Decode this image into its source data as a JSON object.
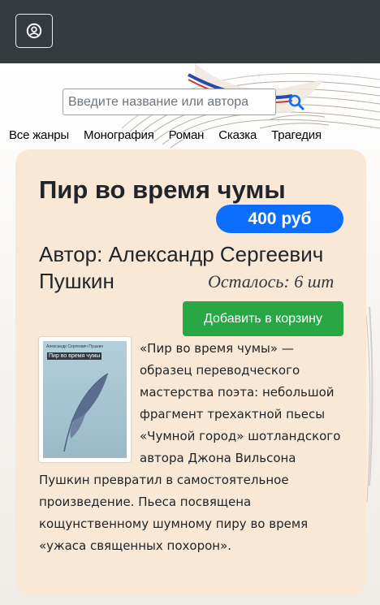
{
  "navbar": {
    "user_icon": "user-circle-icon"
  },
  "search": {
    "placeholder": "Введите название или автора",
    "icon": "search-icon",
    "icon_color": "#0d6efd"
  },
  "genres": [
    "Все жанры",
    "Монография",
    "Роман",
    "Сказка",
    "Трагедия"
  ],
  "book": {
    "title": "Пир во время чумы",
    "price": "400 руб",
    "author": "Автор: Александр Сергеевич Пушкин",
    "stock": "Осталось: 6 шт",
    "add_to_cart": "Добавить в корзину",
    "cover": {
      "author": "Александр Сергеевич Пушкин",
      "title": "Пир во время чумы",
      "icon": "feather-icon"
    },
    "description": "«Пир во время чумы» — образец переводческого мастерства поэта: небольшой фрагмент трехактной пьесы «Чумной город» шотландского автора Джона Вильсона Пушкин превратил в самостоятельное произведение. Пьеса посвящена кощунственному шумному пиру во время «ужаса священных похорон»."
  },
  "colors": {
    "navbar": "#343a40",
    "card": "#f8e8d5",
    "price_badge": "#0d6efd",
    "add_button": "#28a745"
  }
}
